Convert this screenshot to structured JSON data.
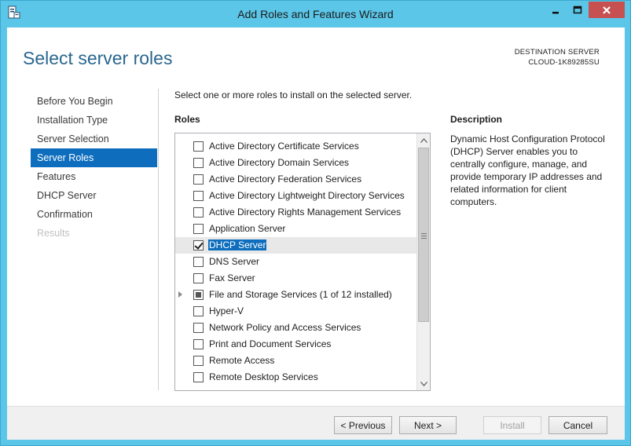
{
  "window": {
    "title": "Add Roles and Features Wizard",
    "icon": "server-manager-icon"
  },
  "header": {
    "page_title": "Select server roles",
    "destination_label": "DESTINATION SERVER",
    "destination_server": "CLOUD-1K89285SU"
  },
  "nav": {
    "items": [
      {
        "label": "Before You Begin",
        "state": "normal"
      },
      {
        "label": "Installation Type",
        "state": "normal"
      },
      {
        "label": "Server Selection",
        "state": "normal"
      },
      {
        "label": "Server Roles",
        "state": "active"
      },
      {
        "label": "Features",
        "state": "normal"
      },
      {
        "label": "DHCP Server",
        "state": "normal"
      },
      {
        "label": "Confirmation",
        "state": "normal"
      },
      {
        "label": "Results",
        "state": "disabled"
      }
    ]
  },
  "main": {
    "instruction": "Select one or more roles to install on the selected server.",
    "roles_label": "Roles",
    "roles": [
      {
        "label": "Active Directory Certificate Services",
        "state": "unchecked"
      },
      {
        "label": "Active Directory Domain Services",
        "state": "unchecked"
      },
      {
        "label": "Active Directory Federation Services",
        "state": "unchecked"
      },
      {
        "label": "Active Directory Lightweight Directory Services",
        "state": "unchecked"
      },
      {
        "label": "Active Directory Rights Management Services",
        "state": "unchecked"
      },
      {
        "label": "Application Server",
        "state": "unchecked"
      },
      {
        "label": "DHCP Server",
        "state": "checked",
        "selected": true
      },
      {
        "label": "DNS Server",
        "state": "unchecked"
      },
      {
        "label": "Fax Server",
        "state": "unchecked"
      },
      {
        "label": "File and Storage Services (1 of 12 installed)",
        "state": "partial",
        "expandable": true
      },
      {
        "label": "Hyper-V",
        "state": "unchecked"
      },
      {
        "label": "Network Policy and Access Services",
        "state": "unchecked"
      },
      {
        "label": "Print and Document Services",
        "state": "unchecked"
      },
      {
        "label": "Remote Access",
        "state": "unchecked"
      },
      {
        "label": "Remote Desktop Services",
        "state": "unchecked"
      }
    ],
    "description_label": "Description",
    "description_text": "Dynamic Host Configuration Protocol (DHCP) Server enables you to centrally configure, manage, and provide temporary IP addresses and related information for client computers."
  },
  "footer": {
    "previous_label": "< Previous",
    "next_label": "Next >",
    "install_label": "Install",
    "cancel_label": "Cancel"
  },
  "colors": {
    "titlebar": "#5bc6e8",
    "accent": "#0e6ebd",
    "heading": "#29668f",
    "close_button": "#c75050"
  }
}
